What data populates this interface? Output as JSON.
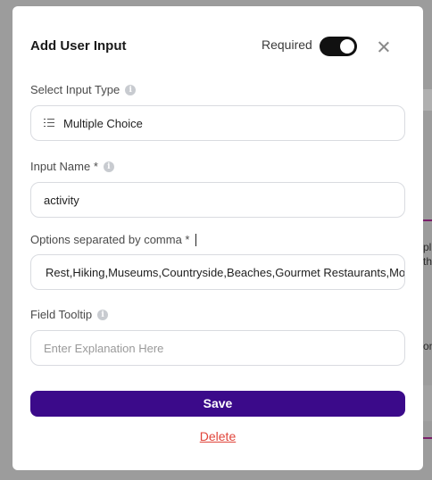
{
  "modal": {
    "title": "Add User Input",
    "required_label": "Required",
    "required_on": true
  },
  "input_type": {
    "label": "Select Input Type",
    "value": "Multiple Choice",
    "icon": "list-icon"
  },
  "input_name": {
    "label": "Input Name *",
    "value": "activity"
  },
  "options": {
    "label": "Options separated by comma *",
    "value": "Rest,Hiking,Museums,Countryside,Beaches,Gourmet Restaurants,Monun"
  },
  "tooltip": {
    "label": "Field Tooltip",
    "placeholder": "Enter Explanation Here"
  },
  "actions": {
    "save_label": "Save",
    "delete_label": "Delete"
  },
  "background_fragments": [
    "pl",
    "the",
    "on"
  ],
  "colors": {
    "save_button": "#3b0a8a",
    "delete_link": "#e0443a",
    "toggle_on": "#111111"
  }
}
